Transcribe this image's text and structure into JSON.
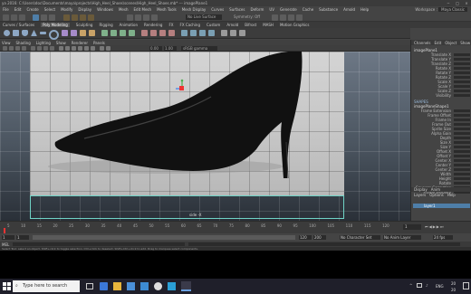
{
  "window": {
    "title": "ya 2016: C:\\Users\\doc\\Documents\\maya\\projects\\High_Heel_Shoes\\scenes\\High_Heel_Shoes.mb* --- imagePlane1",
    "controls": [
      "−",
      "□",
      "×"
    ]
  },
  "menubar": {
    "items": [
      "File",
      "Edit",
      "Create",
      "Select",
      "Modify",
      "Display",
      "Windows",
      "Mesh",
      "Edit Mesh",
      "Mesh Tools",
      "Mesh Display",
      "Curves",
      "Surfaces",
      "Deform",
      "UV",
      "Generate",
      "Cache",
      "Substance",
      "Arnold",
      "Help"
    ]
  },
  "statusline": {
    "workspace": "Workspace :",
    "workspace_value": "Maya Classic",
    "no_live_surface": "No Live Surface",
    "symmetry": "Symmetry: Off"
  },
  "shelf": {
    "tabs": [
      "Curves / Surfaces",
      "Poly Modeling",
      "Sculpting",
      "Rigging",
      "Animation",
      "Rendering",
      "FX",
      "FX Caching",
      "Custom",
      "Arnold",
      "Bifrost",
      "MASH",
      "Motion Graphics"
    ]
  },
  "viewport": {
    "menu": [
      "View",
      "Shading",
      "Lighting",
      "Show",
      "Renderer",
      "Panels"
    ],
    "color_space": "sRGB gamma",
    "camera_label": "side -X",
    "near": "0.00",
    "far": "1.00"
  },
  "attribute_editor": {
    "tabs": [
      "Channels",
      "Edit",
      "Object",
      "Show"
    ],
    "node": "imagePlane1",
    "transform_attrs": [
      "Translate X",
      "Translate Y",
      "Translate Z",
      "Rotate X",
      "Rotate Y",
      "Rotate Z",
      "Scale X",
      "Scale Y",
      "Scale Z",
      "Visibility"
    ],
    "shapes_label": "SHAPES",
    "shape_node": "imagePlaneShape1",
    "shape_attrs": [
      "Frame Extension",
      "Frame Offset",
      "Frame In",
      "Frame Out",
      "Sprite Size",
      "Alpha Gain",
      "Depth",
      "Size X",
      "Size Y",
      "Offset X",
      "Offset Y",
      "Center X",
      "Center Y",
      "Center Z",
      "Width",
      "Height",
      "Rotate",
      "Squeeze Correction",
      "Frame Visibility"
    ],
    "layer_tabs": [
      "Display",
      "Anim"
    ],
    "layer_menu": [
      "Layers",
      "Options",
      "Help"
    ],
    "layer_name": "layer1"
  },
  "timeline": {
    "ticks": [
      "5",
      "10",
      "15",
      "20",
      "25",
      "30",
      "35",
      "40",
      "45",
      "50",
      "55",
      "60",
      "65",
      "70",
      "75",
      "80",
      "85",
      "90",
      "95",
      "100",
      "105",
      "110",
      "115",
      "120"
    ],
    "start": "1",
    "end": "120",
    "range_start": "1",
    "range_end": "120",
    "anim_end": "200",
    "current": "1",
    "no_char_set": "No Character Set",
    "no_anim_layer": "No Anim Layer",
    "fps": "24 fps"
  },
  "cmdline": {
    "mel_label": "MEL",
    "help": "Select Tool: select an object. Shift+click to toggle selection. Ctrl+click to deselect. Shift+Ctrl+click to add. Drag to marquee select components."
  },
  "taskbar": {
    "search_placeholder": "Type here to search",
    "time": "20",
    "date": "20",
    "lang": "ENG"
  },
  "colors": {
    "accent_teal": "#6fd3c6",
    "selection_blue": "#4e7ea8"
  }
}
